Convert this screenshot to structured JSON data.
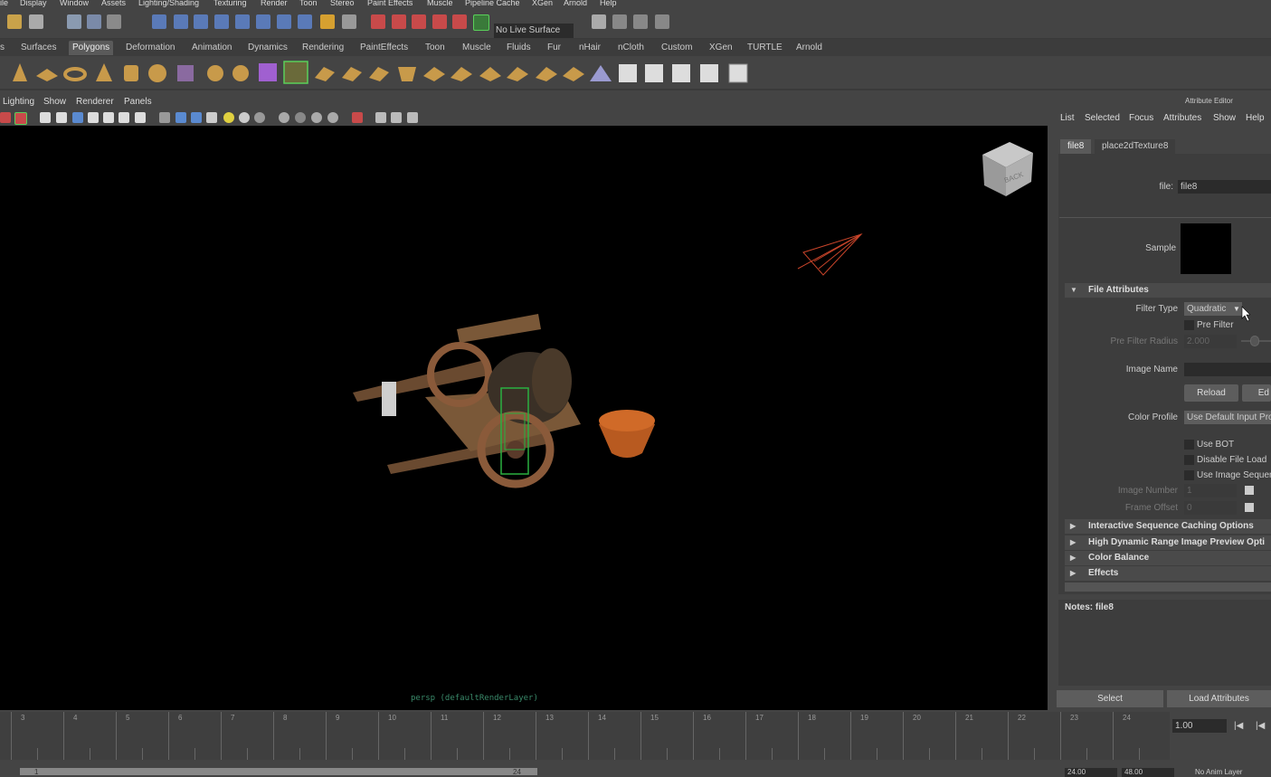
{
  "menubar": [
    "ile",
    "Display",
    "Window",
    "Assets",
    "Lighting/Shading",
    "Texturing",
    "Render",
    "Toon",
    "Stereo",
    "Paint Effects",
    "Muscle",
    "Pipeline Cache",
    "XGen",
    "Arnold",
    "Help"
  ],
  "statusline": {
    "live_surface": "No Live Surface"
  },
  "shelf_tabs": [
    "s",
    "Surfaces",
    "Polygons",
    "Deformation",
    "Animation",
    "Dynamics",
    "Rendering",
    "PaintEffects",
    "Toon",
    "Muscle",
    "Fluids",
    "Fur",
    "nHair",
    "nCloth",
    "Custom",
    "XGen",
    "TURTLE",
    "Arnold"
  ],
  "shelf_active": "Polygons",
  "panel_menu": [
    "Lighting",
    "Show",
    "Renderer",
    "Panels"
  ],
  "viewport": {
    "camera_label": "persp (defaultRenderLayer)",
    "viewcube_face": "BACK"
  },
  "attribute_editor": {
    "title": "Attribute Editor",
    "menu": [
      "List",
      "Selected",
      "Focus",
      "Attributes",
      "Show",
      "Help"
    ],
    "tabs": [
      "file8",
      "place2dTexture8"
    ],
    "file_label": "file:",
    "file_value": "file8",
    "sample_label": "Sample",
    "file_attributes": {
      "header": "File Attributes",
      "filter_type_label": "Filter Type",
      "filter_type_value": "Quadratic",
      "pre_filter_label": "Pre Filter",
      "pre_filter_radius_label": "Pre Filter Radius",
      "pre_filter_radius_value": "2.000",
      "image_name_label": "Image Name",
      "image_name_value": "",
      "reload_label": "Reload",
      "edit_label": "Ed",
      "color_profile_label": "Color Profile",
      "color_profile_value": "Use Default Input Pro",
      "use_bot_label": "Use BOT",
      "disable_file_load_label": "Disable File Load",
      "use_image_sequence_label": "Use Image Sequenc",
      "image_number_label": "Image Number",
      "image_number_value": "1",
      "frame_offset_label": "Frame Offset",
      "frame_offset_value": "0"
    },
    "collapsed_sections": [
      "Interactive Sequence Caching Options",
      "High Dynamic Range Image Preview Opti",
      "Color Balance",
      "Effects"
    ],
    "notes_label": "Notes:  file8",
    "select_label": "Select",
    "load_attributes_label": "Load Attributes"
  },
  "timeline": {
    "ticks": [
      "3",
      "4",
      "5",
      "6",
      "7",
      "8",
      "9",
      "10",
      "11",
      "12",
      "13",
      "14",
      "15",
      "16",
      "17",
      "18",
      "19",
      "20",
      "21",
      "22",
      "23",
      "24"
    ],
    "current_frame": "1.00"
  },
  "range": {
    "start": "1",
    "end_marker": "24",
    "end": "24.00",
    "anim_end": "48.00",
    "anim_layer": "No Anim Layer"
  }
}
